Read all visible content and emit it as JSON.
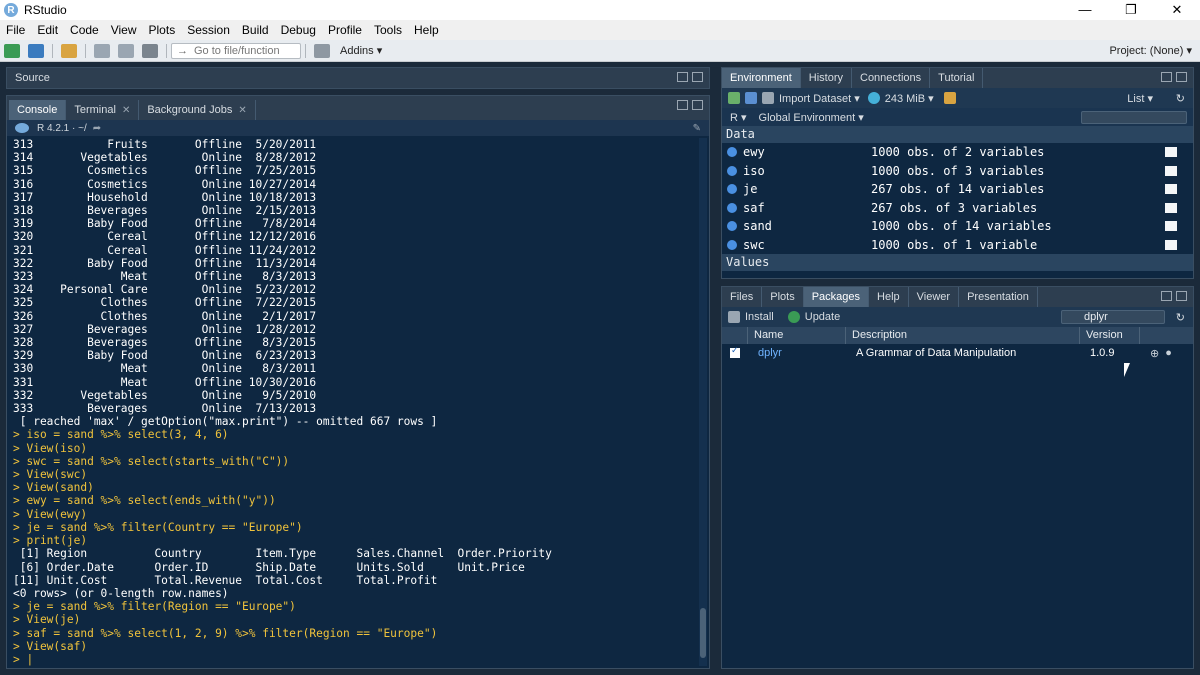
{
  "window": {
    "title": "RStudio",
    "controls": [
      "—",
      "❐",
      "✕"
    ]
  },
  "menu": [
    "File",
    "Edit",
    "Code",
    "View",
    "Plots",
    "Session",
    "Build",
    "Debug",
    "Profile",
    "Tools",
    "Help"
  ],
  "toolbar": {
    "goto_placeholder": "Go to file/function",
    "addins": "Addins ▾",
    "project": "Project: (None) ▾"
  },
  "source": {
    "title": "Source"
  },
  "console": {
    "tabs": [
      "Console",
      "Terminal",
      "Background Jobs"
    ],
    "r_version": "R 4.2.1 · ~/",
    "lines": [
      {
        "t": "out",
        "v": "313           Fruits       Offline  5/20/2011"
      },
      {
        "t": "out",
        "v": "314       Vegetables        Online  8/28/2012"
      },
      {
        "t": "out",
        "v": "315        Cosmetics       Offline  7/25/2015"
      },
      {
        "t": "out",
        "v": "316        Cosmetics        Online 10/27/2014"
      },
      {
        "t": "out",
        "v": "317        Household        Online 10/18/2013"
      },
      {
        "t": "out",
        "v": "318        Beverages        Online  2/15/2013"
      },
      {
        "t": "out",
        "v": "319        Baby Food       Offline   7/8/2014"
      },
      {
        "t": "out",
        "v": "320           Cereal       Offline 12/12/2016"
      },
      {
        "t": "out",
        "v": "321           Cereal       Offline 11/24/2012"
      },
      {
        "t": "out",
        "v": "322        Baby Food       Offline  11/3/2014"
      },
      {
        "t": "out",
        "v": "323             Meat       Offline   8/3/2013"
      },
      {
        "t": "out",
        "v": "324    Personal Care        Online  5/23/2012"
      },
      {
        "t": "out",
        "v": "325          Clothes       Offline  7/22/2015"
      },
      {
        "t": "out",
        "v": "326          Clothes        Online   2/1/2017"
      },
      {
        "t": "out",
        "v": "327        Beverages        Online  1/28/2012"
      },
      {
        "t": "out",
        "v": "328        Beverages       Offline   8/3/2015"
      },
      {
        "t": "out",
        "v": "329        Baby Food        Online  6/23/2013"
      },
      {
        "t": "out",
        "v": "330             Meat        Online   8/3/2011"
      },
      {
        "t": "out",
        "v": "331             Meat       Offline 10/30/2016"
      },
      {
        "t": "out",
        "v": "332       Vegetables        Online   9/5/2010"
      },
      {
        "t": "out",
        "v": "333        Beverages        Online  7/13/2013"
      },
      {
        "t": "out",
        "v": " [ reached 'max' / getOption(\"max.print\") -- omitted 667 rows ]"
      },
      {
        "t": "cmd",
        "v": "> iso = sand %>% select(3, 4, 6)"
      },
      {
        "t": "cmd",
        "v": "> View(iso)"
      },
      {
        "t": "cmd",
        "v": "> swc = sand %>% select(starts_with(\"C\"))"
      },
      {
        "t": "cmd",
        "v": "> View(swc)"
      },
      {
        "t": "cmd",
        "v": "> View(sand)"
      },
      {
        "t": "cmd",
        "v": "> ewy = sand %>% select(ends_with(\"y\"))"
      },
      {
        "t": "cmd",
        "v": "> View(ewy)"
      },
      {
        "t": "cmd",
        "v": "> je = sand %>% filter(Country == \"Europe\")"
      },
      {
        "t": "cmd",
        "v": "> print(je)"
      },
      {
        "t": "out",
        "v": " [1] Region          Country        Item.Type      Sales.Channel  Order.Priority"
      },
      {
        "t": "out",
        "v": " [6] Order.Date      Order.ID       Ship.Date      Units.Sold     Unit.Price"
      },
      {
        "t": "out",
        "v": "[11] Unit.Cost       Total.Revenue  Total.Cost     Total.Profit"
      },
      {
        "t": "out",
        "v": "<0 rows> (or 0-length row.names)"
      },
      {
        "t": "cmd",
        "v": "> je = sand %>% filter(Region == \"Europe\")"
      },
      {
        "t": "cmd",
        "v": "> View(je)"
      },
      {
        "t": "cmd",
        "v": "> saf = sand %>% select(1, 2, 9) %>% filter(Region == \"Europe\")"
      },
      {
        "t": "cmd",
        "v": "> View(saf)"
      },
      {
        "t": "cmd",
        "v": "> |"
      }
    ]
  },
  "environment": {
    "tabs": [
      "Environment",
      "History",
      "Connections",
      "Tutorial"
    ],
    "import_label": "Import Dataset ▾",
    "memory": "243 MiB ▾",
    "list_label": "List ▾",
    "lang": "R ▾",
    "scope": "Global Environment ▾",
    "data_header": "Data",
    "values_header": "Values",
    "rows": [
      {
        "name": "ewy",
        "desc": "1000 obs. of 2 variables"
      },
      {
        "name": "iso",
        "desc": "1000 obs. of 3 variables"
      },
      {
        "name": "je",
        "desc": "267 obs. of 14 variables"
      },
      {
        "name": "saf",
        "desc": "267 obs. of 3 variables"
      },
      {
        "name": "sand",
        "desc": "1000 obs. of 14 variables"
      },
      {
        "name": "swc",
        "desc": "1000 obs. of 1 variable"
      }
    ]
  },
  "packages": {
    "tabs": [
      "Files",
      "Plots",
      "Packages",
      "Help",
      "Viewer",
      "Presentation"
    ],
    "install": "Install",
    "update": "Update",
    "search_value": "dplyr",
    "columns": [
      "Name",
      "Description",
      "Version"
    ],
    "row": {
      "name": "dplyr",
      "description": "A Grammar of Data Manipulation",
      "version": "1.0.9"
    }
  }
}
